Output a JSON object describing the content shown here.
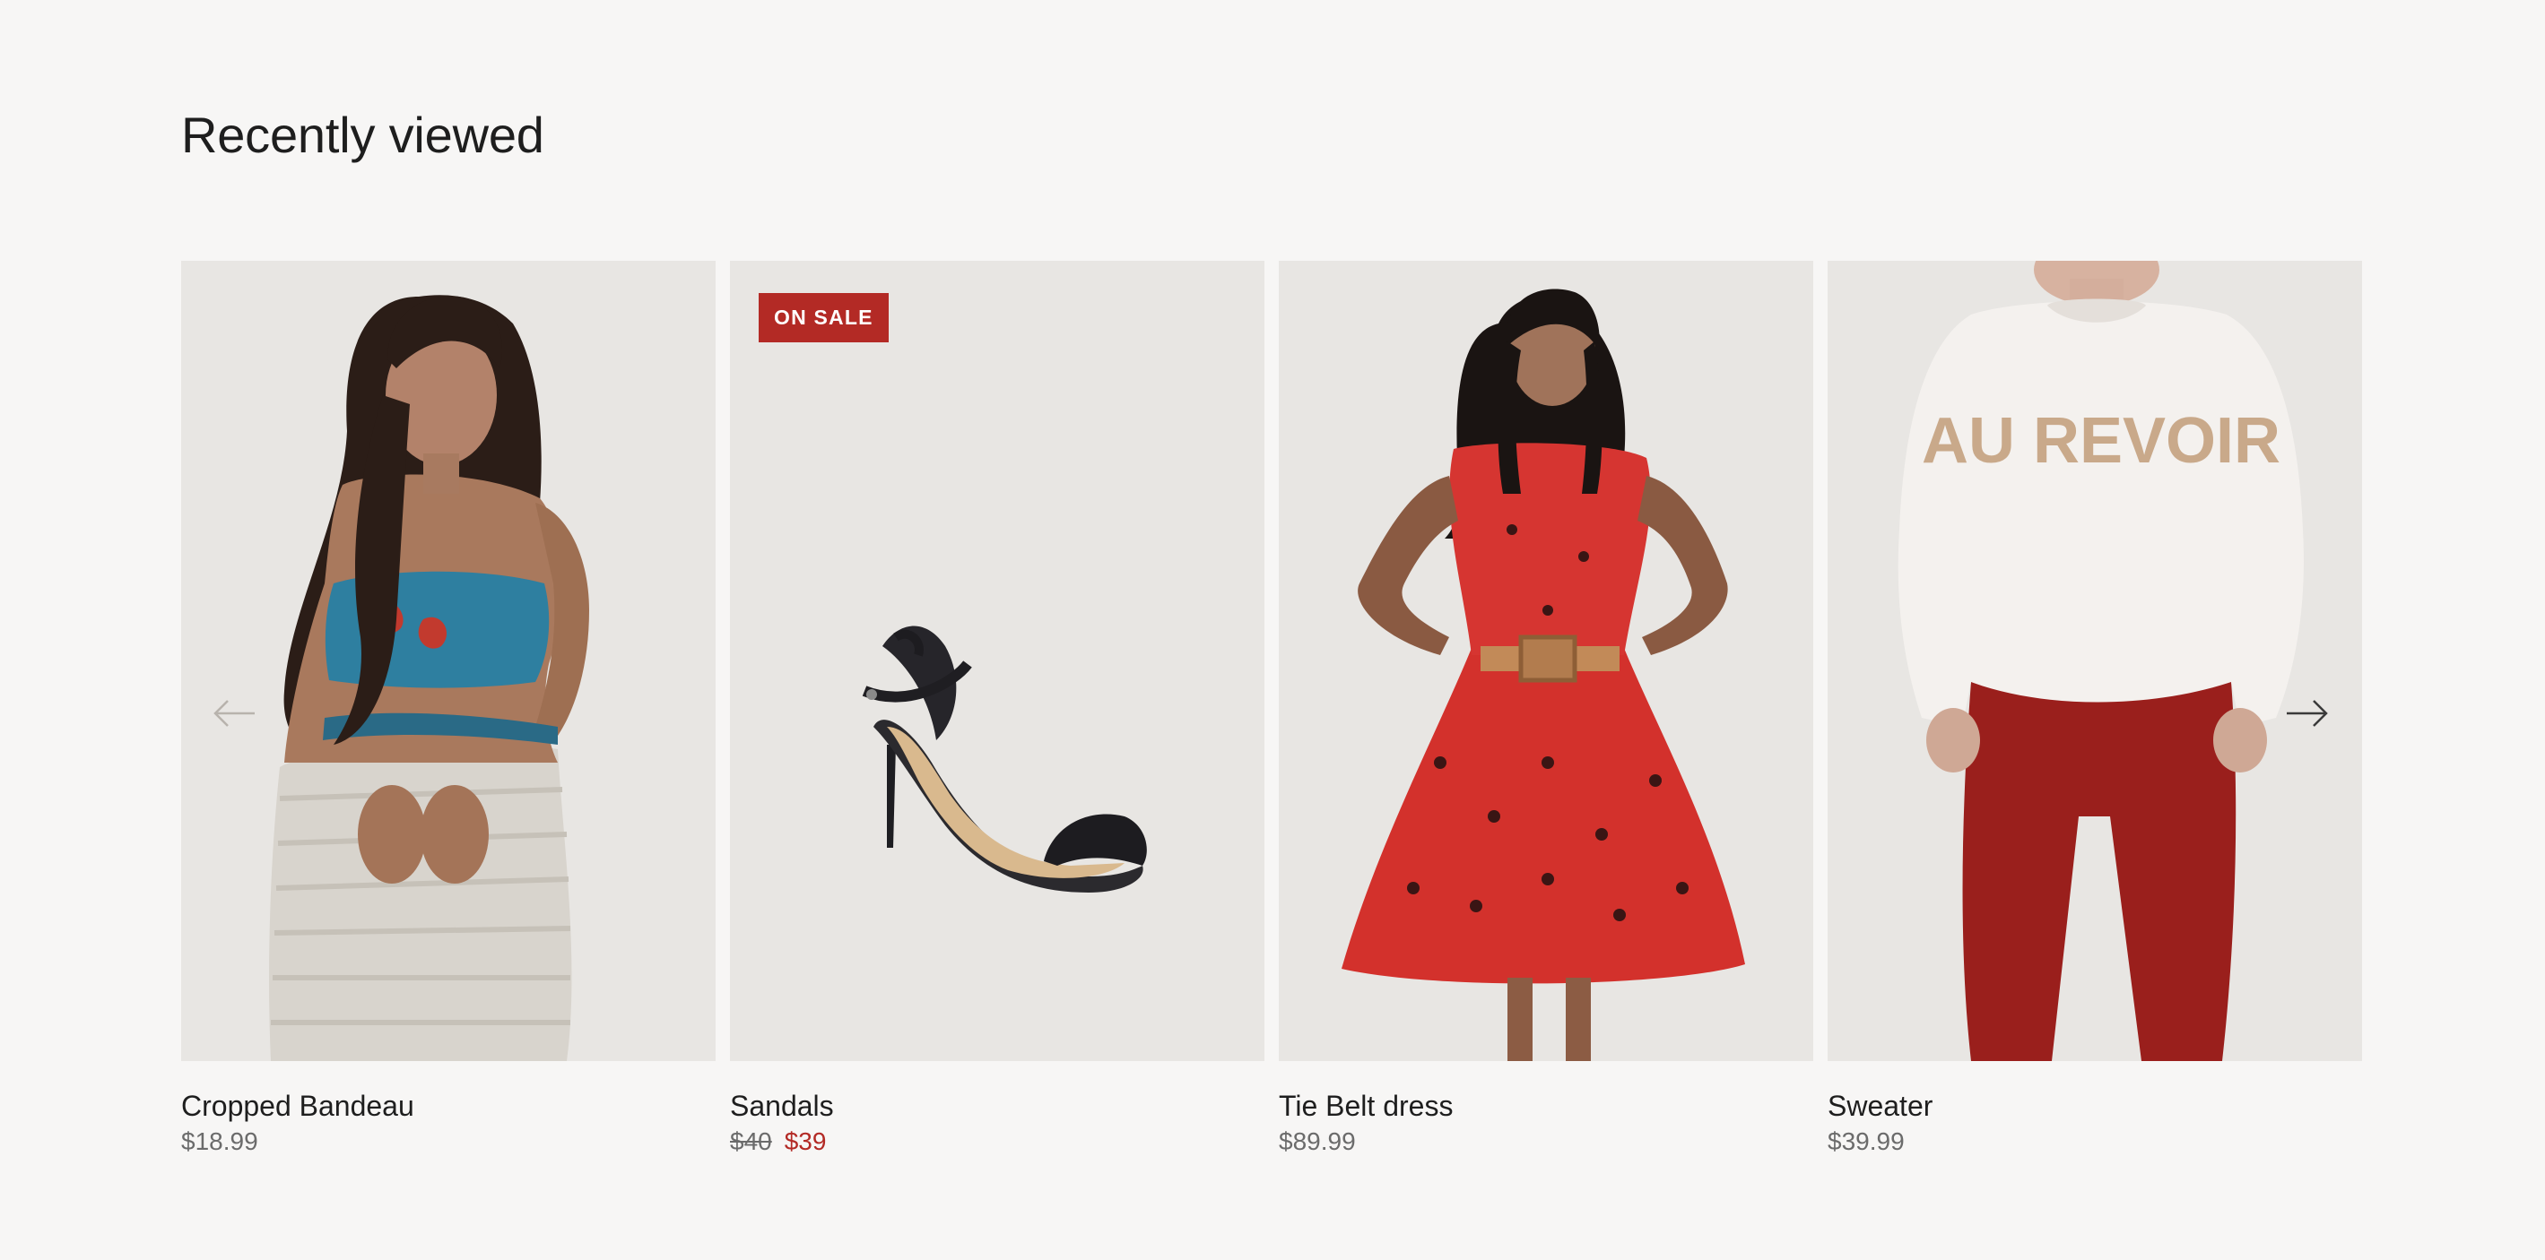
{
  "section": {
    "title": "Recently viewed"
  },
  "products": [
    {
      "name": "Cropped Bandeau",
      "price": "$18.99",
      "image": "woman-in-blue-floral-bandeau-and-crochet-skirt"
    },
    {
      "name": "Sandals",
      "badge": "ON SALE",
      "price_original": "$40",
      "price_sale": "$39",
      "image": "black-strappy-high-heel-sandal"
    },
    {
      "name": "Tie Belt dress",
      "price": "$89.99",
      "image": "woman-in-red-floral-dress-with-tie-belt"
    },
    {
      "name": "Sweater",
      "price": "$39.99",
      "image": "white-sweater-au-revoir-with-red-pants",
      "image_text": "AU REVOIR"
    }
  ],
  "carousel": {
    "prev_icon": "arrow-left-icon",
    "next_icon": "arrow-right-icon"
  },
  "colors": {
    "background": "#f7f6f5",
    "card_background": "#e8e6e3",
    "sale_red": "#b32a25",
    "text": "#1e1e1e",
    "muted_text": "#6b6b6b"
  }
}
